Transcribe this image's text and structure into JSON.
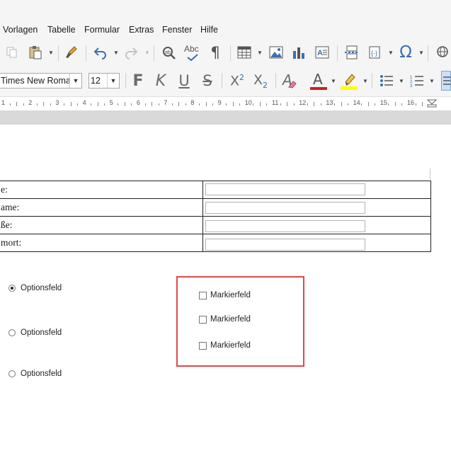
{
  "menubar": {
    "items": [
      "Vorlagen",
      "Tabelle",
      "Formular",
      "Extras",
      "Fenster",
      "Hilfe"
    ]
  },
  "toolbar_icons": {
    "copy": "copy-icon",
    "paste": "paste-icon",
    "clone": "clone-formatting-icon",
    "undo": "undo-icon",
    "redo": "redo-icon",
    "find": "find-replace-icon",
    "spell": "spelling-icon",
    "formatting_marks": "formatting-marks-icon",
    "table": "table-icon",
    "image": "image-icon",
    "chart": "chart-icon",
    "textbox": "textbox-icon",
    "page_break": "page-break-icon",
    "field": "field-icon",
    "special_char": "special-character-icon",
    "hyperlink": "hyperlink-icon",
    "spell_text": "Abc",
    "omega": "Ω",
    "pilcrow": "¶"
  },
  "formatting": {
    "font_name": "Times New Roman",
    "font_size": "12",
    "bold": "F",
    "italic": "K",
    "underline": "U",
    "strike": "S",
    "superscript": "X",
    "superscript_mark": "2",
    "subscript": "X",
    "subscript_mark": "2",
    "font_color_letter": "A",
    "clear_letter": "A",
    "colors": {
      "font_color": "#c9211e",
      "highlight": "#ffff00"
    }
  },
  "ruler": {
    "labels": [
      "1",
      "2",
      "3",
      "4",
      "5",
      "6",
      "7",
      "8",
      "9",
      "10",
      "11",
      "12",
      "13",
      "14",
      "15",
      "16"
    ]
  },
  "form_table": {
    "rows": [
      {
        "label": "e:"
      },
      {
        "label": "ame:"
      },
      {
        "label": "ße:"
      },
      {
        "label": "mort:"
      }
    ]
  },
  "option_fields": [
    {
      "label": "Optionsfeld",
      "selected": true
    },
    {
      "label": "Optionsfeld",
      "selected": false
    },
    {
      "label": "Optionsfeld",
      "selected": false
    }
  ],
  "checkboxes": [
    {
      "label": "Markierfeld",
      "checked": false
    },
    {
      "label": "Markierfeld",
      "checked": false
    },
    {
      "label": "Markierfeld",
      "checked": false
    }
  ],
  "highlight_color": "#e04848"
}
